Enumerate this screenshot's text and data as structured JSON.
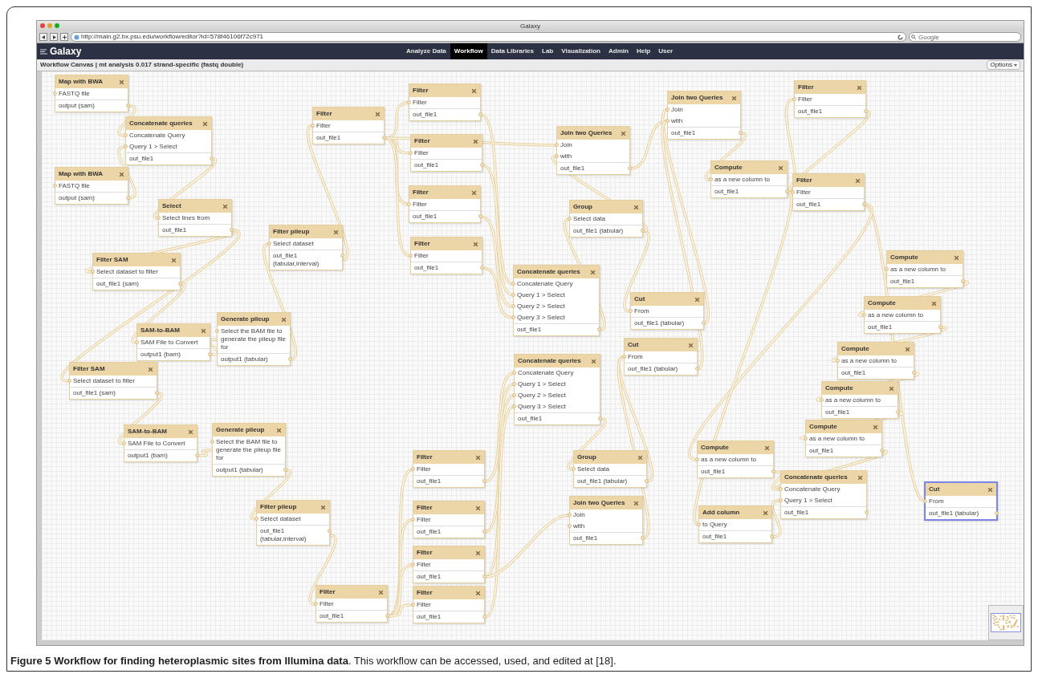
{
  "browser": {
    "title": "Galaxy",
    "url": "http://main.g2.bx.psu.edu/workflow/editor?id=578f46106f72c971",
    "search": {
      "placeholder": "Google"
    }
  },
  "masthead": {
    "logo": "Galaxy",
    "nav": [
      {
        "label": "Analyze Data",
        "selected": false
      },
      {
        "label": "Workflow",
        "selected": true
      },
      {
        "label": "Data Libraries",
        "selected": false
      },
      {
        "label": "Lab",
        "selected": false
      },
      {
        "label": "Visualization",
        "selected": false
      },
      {
        "label": "Admin",
        "selected": false
      },
      {
        "label": "Help",
        "selected": false
      },
      {
        "label": "User",
        "selected": false
      }
    ]
  },
  "canvas_header": {
    "title": "Workflow Canvas | mt analysis 0.017 strand-specific (fastq double)",
    "options": "Options"
  },
  "nodes": [
    {
      "title": "Map with BWA",
      "inputs": [
        "FASTQ file"
      ],
      "outputs": [
        "output (sam)"
      ],
      "selected": false
    },
    {
      "title": "Concatenate queries",
      "inputs": [
        "Concatenate Query",
        "Query 1 > Select"
      ],
      "outputs": [
        "out_file1"
      ],
      "selected": false
    },
    {
      "title": "Map with BWA",
      "inputs": [
        "FASTQ file"
      ],
      "outputs": [
        "output (sam)"
      ],
      "selected": false
    },
    {
      "title": "Select",
      "inputs": [
        "Select lines from"
      ],
      "outputs": [
        "out_file1"
      ],
      "selected": false
    },
    {
      "title": "Filter SAM",
      "inputs": [
        "Select dataset to filter"
      ],
      "outputs": [
        "out_file1 (sam)"
      ],
      "selected": false
    },
    {
      "title": "SAM-to-BAM",
      "inputs": [
        "SAM File to Convert"
      ],
      "outputs": [
        "output1 (bam)"
      ],
      "selected": false
    },
    {
      "title": "Generate pileup",
      "inputs": [
        "Select the BAM file to generate the pileup file for"
      ],
      "outputs": [
        "output1 (tabular)"
      ],
      "selected": false
    },
    {
      "title": "Filter SAM",
      "inputs": [
        "Select dataset to filter"
      ],
      "outputs": [
        "out_file1 (sam)"
      ],
      "selected": false
    },
    {
      "title": "SAM-to-BAM",
      "inputs": [
        "SAM File to Convert"
      ],
      "outputs": [
        "output1 (bam)"
      ],
      "selected": false
    },
    {
      "title": "Generate pileup",
      "inputs": [
        "Select the BAM file to generate the pileup file for"
      ],
      "outputs": [
        "output1 (tabular)"
      ],
      "selected": false
    },
    {
      "title": "Filter pileup",
      "inputs": [
        "Select dataset"
      ],
      "outputs": [
        "out_file1 (tabular,interval)"
      ],
      "selected": false
    },
    {
      "title": "Filter pileup",
      "inputs": [
        "Select dataset"
      ],
      "outputs": [
        "out_file1 (tabular,interval)"
      ],
      "selected": false
    },
    {
      "title": "Filter",
      "inputs": [
        "Filter"
      ],
      "outputs": [
        "out_file1"
      ],
      "selected": false
    },
    {
      "title": "Filter",
      "inputs": [
        "Filter"
      ],
      "outputs": [
        "out_file1"
      ],
      "selected": false
    },
    {
      "title": "Filter",
      "inputs": [
        "Filter"
      ],
      "outputs": [
        "out_file1"
      ],
      "selected": false
    },
    {
      "title": "Filter",
      "inputs": [
        "Filter"
      ],
      "outputs": [
        "out_file1"
      ],
      "selected": false
    },
    {
      "title": "Filter",
      "inputs": [
        "Filter"
      ],
      "outputs": [
        "out_file1"
      ],
      "selected": false
    },
    {
      "title": "Join two Queries",
      "inputs": [
        "Join",
        "with"
      ],
      "outputs": [
        "out_file1"
      ],
      "selected": false
    },
    {
      "title": "Concatenate queries",
      "inputs": [
        "Concatenate Query",
        "Query 1 > Select",
        "Query 2 > Select",
        "Query 3 > Select"
      ],
      "outputs": [
        "out_file1"
      ],
      "selected": false
    },
    {
      "title": "Group",
      "inputs": [
        "Select data"
      ],
      "outputs": [
        "out_file1 (tabular)"
      ],
      "selected": false
    },
    {
      "title": "Join two Queries",
      "inputs": [
        "Join",
        "with"
      ],
      "outputs": [
        "out_file1"
      ],
      "selected": false
    },
    {
      "title": "Filter",
      "inputs": [
        "Filter"
      ],
      "outputs": [
        "out_file1"
      ],
      "selected": false
    },
    {
      "title": "Compute",
      "inputs": [
        "as a new column to"
      ],
      "outputs": [
        "out_file1"
      ],
      "selected": false
    },
    {
      "title": "Filter",
      "inputs": [
        "Filter"
      ],
      "outputs": [
        "out_file1"
      ],
      "selected": false
    },
    {
      "title": "Cut",
      "inputs": [
        "From"
      ],
      "outputs": [
        "out_file1 (tabular)"
      ],
      "selected": false
    },
    {
      "title": "Cut",
      "inputs": [
        "From"
      ],
      "outputs": [
        "out_file1 (tabular)"
      ],
      "selected": false
    },
    {
      "title": "Concatenate queries",
      "inputs": [
        "Concatenate Query",
        "Query 1 > Select",
        "Query 2 > Select",
        "Query 3 > Select"
      ],
      "outputs": [
        "out_file1"
      ],
      "selected": false
    },
    {
      "title": "Compute",
      "inputs": [
        "as a new column to"
      ],
      "outputs": [
        "out_file1"
      ],
      "selected": false
    },
    {
      "title": "Compute",
      "inputs": [
        "as a new column to"
      ],
      "outputs": [
        "out_file1"
      ],
      "selected": false
    },
    {
      "title": "Compute",
      "inputs": [
        "as a new column to"
      ],
      "outputs": [
        "out_file1"
      ],
      "selected": false
    },
    {
      "title": "Compute",
      "inputs": [
        "as a new column to"
      ],
      "outputs": [
        "out_file1"
      ],
      "selected": false
    },
    {
      "title": "Compute",
      "inputs": [
        "as a new column to"
      ],
      "outputs": [
        "out_file1"
      ],
      "selected": false
    },
    {
      "title": "Group",
      "inputs": [
        "Select data"
      ],
      "outputs": [
        "out_file1 (tabular)"
      ],
      "selected": false
    },
    {
      "title": "Join two Queries",
      "inputs": [
        "Join",
        "with"
      ],
      "outputs": [
        "out_file1"
      ],
      "selected": false
    },
    {
      "title": "Compute",
      "inputs": [
        "as a new column to"
      ],
      "outputs": [
        "out_file1"
      ],
      "selected": false
    },
    {
      "title": "Add column",
      "inputs": [
        "to Query"
      ],
      "outputs": [
        "out_file1"
      ],
      "selected": false
    },
    {
      "title": "Concatenate queries",
      "inputs": [
        "Concatenate Query",
        "Query 1 > Select"
      ],
      "outputs": [
        "out_file1"
      ],
      "selected": false
    },
    {
      "title": "Cut",
      "inputs": [
        "From"
      ],
      "outputs": [
        "out_file1 (tabular)"
      ],
      "selected": true
    },
    {
      "title": "Filter",
      "inputs": [
        "Filter"
      ],
      "outputs": [
        "out_file1"
      ],
      "selected": false
    },
    {
      "title": "Filter",
      "inputs": [
        "Filter"
      ],
      "outputs": [
        "out_file1"
      ],
      "selected": false
    },
    {
      "title": "Filter",
      "inputs": [
        "Filter"
      ],
      "outputs": [
        "out_file1"
      ],
      "selected": false
    },
    {
      "title": "Filter",
      "inputs": [
        "Filter"
      ],
      "outputs": [
        "out_file1"
      ],
      "selected": false
    },
    {
      "title": "Filter",
      "inputs": [
        "Filter"
      ],
      "outputs": [
        "out_file1"
      ],
      "selected": false
    }
  ],
  "caption": "**Figure 5 Workflow for finding heteroplasmic sites from Illumina data**. This workflow can be accessed, used, and edited at [18]."
}
